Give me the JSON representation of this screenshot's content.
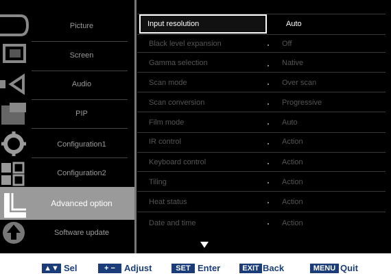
{
  "sidebar": {
    "items": [
      {
        "label": "Picture",
        "icon": "picture-icon"
      },
      {
        "label": "Screen",
        "icon": "screen-icon"
      },
      {
        "label": "Audio",
        "icon": "audio-icon"
      },
      {
        "label": "PIP",
        "icon": "pip-icon"
      },
      {
        "label": "Configuration1",
        "icon": "gear-icon"
      },
      {
        "label": "Configuration2",
        "icon": "grid-icon"
      },
      {
        "label": "Advanced option",
        "icon": "advanced-icon"
      },
      {
        "label": "Software update",
        "icon": "update-icon"
      }
    ],
    "active_index": 6
  },
  "menu": {
    "rows": [
      {
        "name": "Input resolution",
        "value": "Auto"
      },
      {
        "name": "Black level expansion",
        "value": "Off"
      },
      {
        "name": "Gamma selection",
        "value": "Native"
      },
      {
        "name": "Scan mode",
        "value": "Over scan"
      },
      {
        "name": "Scan conversion",
        "value": "Progressive"
      },
      {
        "name": "Film mode",
        "value": "Auto"
      },
      {
        "name": "IR control",
        "value": "Action"
      },
      {
        "name": "Keyboard control",
        "value": "Action"
      },
      {
        "name": "Tiling",
        "value": "Action"
      },
      {
        "name": "Heat status",
        "value": "Action"
      },
      {
        "name": "Date and time",
        "value": "Action"
      }
    ],
    "selected_index": 0
  },
  "help": {
    "sel_key": "▲▼",
    "sel_label": "Sel",
    "adjust_key": "+ −",
    "adjust_label": "Adjust",
    "set_key": "SET",
    "set_label": "Enter",
    "exit_key": "EXIT",
    "exit_label": "Back",
    "menu_key": "MENU",
    "menu_label": "Quit"
  },
  "colors": {
    "osd_bg": "#000000",
    "highlight": "#9a9a9a",
    "help_text": "#1a3d7a"
  }
}
